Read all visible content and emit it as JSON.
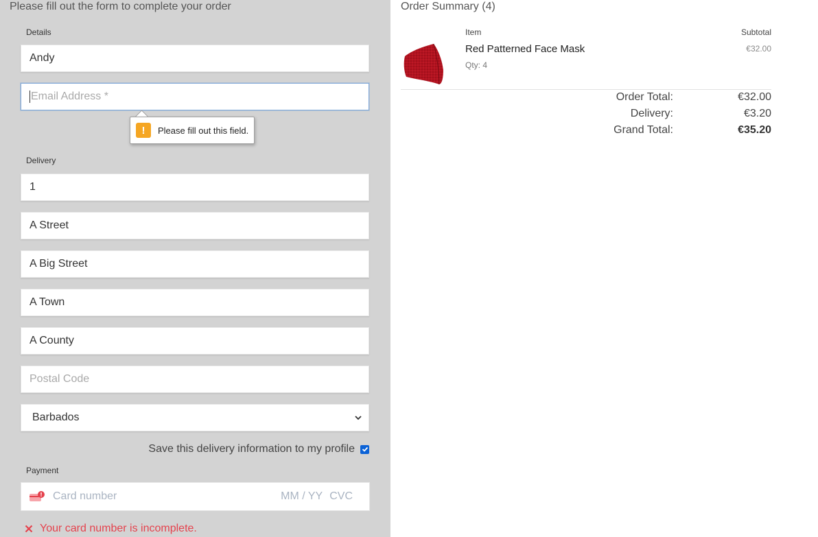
{
  "form": {
    "heading": "Please fill out the form to complete your order",
    "details_label": "Details",
    "name_value": "Andy",
    "email_placeholder": "Email Address *",
    "tooltip_text": "Please fill out this field.",
    "delivery_label": "Delivery",
    "phone_value": "1",
    "street1_value": "A Street",
    "street2_value": "A Big Street",
    "town_value": "A Town",
    "county_value": "A County",
    "postcode_placeholder": "Postal Code",
    "country_value": "Barbados",
    "save_label": "Save this delivery information to my profile",
    "save_checked": true,
    "payment_label": "Payment",
    "card_placeholder": "Card number",
    "expiry_placeholder": "MM / YY",
    "cvc_placeholder": "CVC",
    "card_error": "Your card number is incomplete."
  },
  "summary": {
    "title": "Order Summary (4)",
    "item_header": "Item",
    "subtotal_header": "Subtotal",
    "item": {
      "name": "Red Patterned Face Mask",
      "qty": "Qty: 4",
      "price": "€32.00"
    },
    "order_total_label": "Order Total:",
    "order_total_value": "€32.00",
    "delivery_label": "Delivery:",
    "delivery_value": "€3.20",
    "grand_total_label": "Grand Total:",
    "grand_total_value": "€35.20"
  },
  "colors": {
    "left_panel_bg": "#d3d3d3",
    "error": "#e5424d",
    "warning": "#f5a623",
    "checkbox": "#0b62d6",
    "mask": "#b3121f"
  }
}
